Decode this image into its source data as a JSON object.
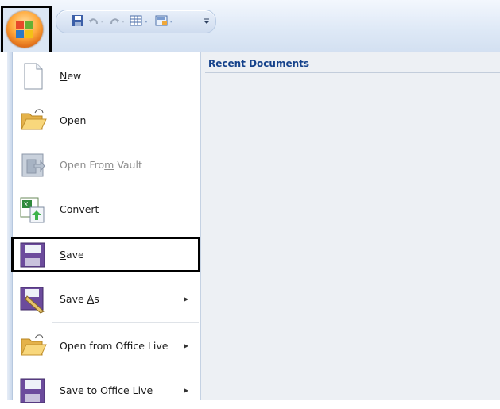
{
  "quick_access": {
    "icons": [
      "office-orb-icon",
      "save-icon",
      "undo-icon",
      "redo-icon",
      "table-icon",
      "document-icon",
      "customize-icon"
    ]
  },
  "recent": {
    "title": "Recent Documents"
  },
  "menu": {
    "items": [
      {
        "id": "new",
        "pre": "",
        "u": "N",
        "post": "ew",
        "icon": "new-document-icon",
        "disabled": false,
        "arrow": false
      },
      {
        "id": "open",
        "pre": "",
        "u": "O",
        "post": "pen",
        "icon": "folder-icon",
        "disabled": false,
        "arrow": false
      },
      {
        "id": "open-from-vault",
        "pre": "Open Fro",
        "u": "m",
        "post": " Vault",
        "icon": "vault-icon",
        "disabled": true,
        "arrow": false
      },
      {
        "id": "convert",
        "pre": "Con",
        "u": "v",
        "post": "ert",
        "icon": "convert-icon",
        "disabled": false,
        "arrow": false
      },
      {
        "id": "save",
        "pre": "",
        "u": "S",
        "post": "ave",
        "icon": "save-icon",
        "disabled": false,
        "arrow": false
      },
      {
        "id": "save-as",
        "pre": "Save ",
        "u": "A",
        "post": "s",
        "icon": "save-as-icon",
        "disabled": false,
        "arrow": true
      },
      {
        "id": "open-office-live",
        "pre": "Open from Office Live",
        "u": "",
        "post": "",
        "icon": "folder-icon",
        "disabled": false,
        "arrow": true
      },
      {
        "id": "save-office-live",
        "pre": "Save to Office Live",
        "u": "",
        "post": "",
        "icon": "save-icon",
        "disabled": false,
        "arrow": true
      }
    ],
    "arrow_glyph": "▶"
  }
}
